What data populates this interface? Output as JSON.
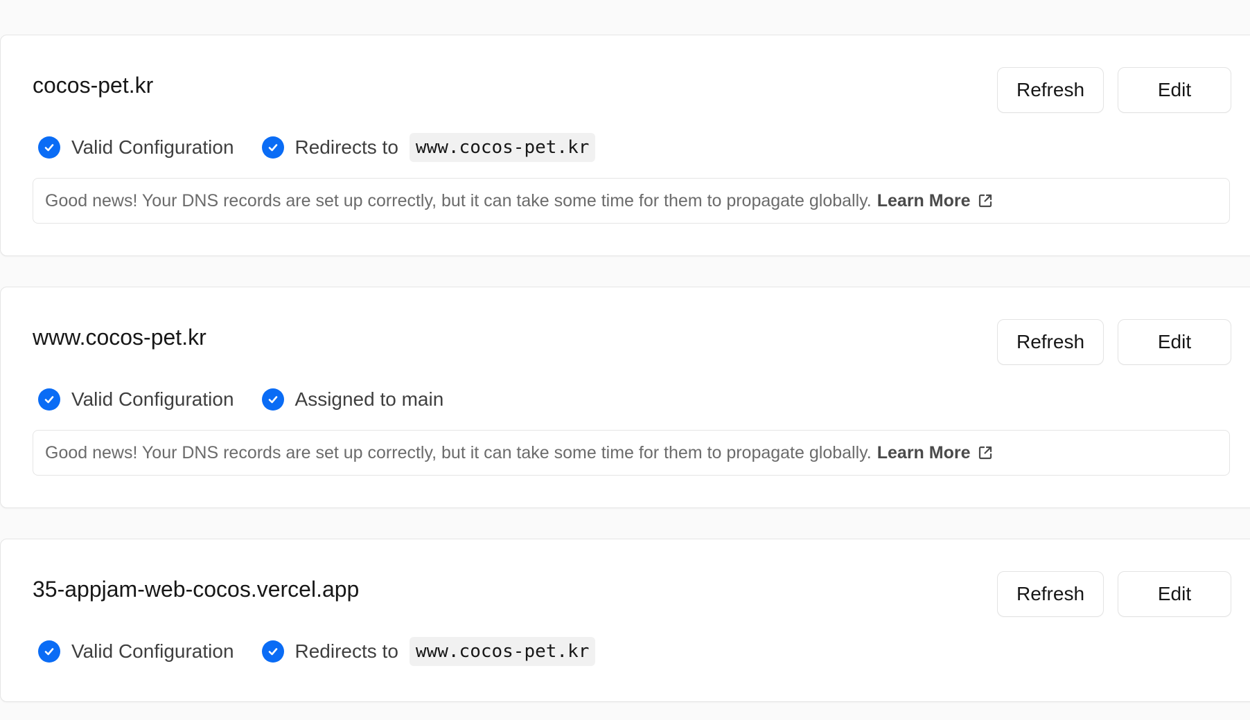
{
  "colors": {
    "check_blue": "#0a6cf5",
    "page_background": "#fafafa",
    "card_background": "#ffffff"
  },
  "domains": [
    {
      "name": "cocos-pet.kr",
      "refresh_label": "Refresh",
      "edit_label": "Edit",
      "status_1": "Valid Configuration",
      "status_2": "Redirects to",
      "status_2_target": "www.cocos-pet.kr",
      "notice_text": "Good news! Your DNS records are set up correctly, but it can take some time for them to propagate globally.",
      "notice_link": "Learn More",
      "icons": [
        "check-circle-icon",
        "external-link-icon"
      ]
    },
    {
      "name": "www.cocos-pet.kr",
      "refresh_label": "Refresh",
      "edit_label": "Edit",
      "status_1": "Valid Configuration",
      "status_2": "Assigned to main",
      "notice_text": "Good news! Your DNS records are set up correctly, but it can take some time for them to propagate globally.",
      "notice_link": "Learn More",
      "icons": [
        "check-circle-icon",
        "external-link-icon"
      ]
    },
    {
      "name": "35-appjam-web-cocos.vercel.app",
      "refresh_label": "Refresh",
      "edit_label": "Edit",
      "status_1": "Valid Configuration",
      "status_2": "Redirects to",
      "status_2_target": "www.cocos-pet.kr",
      "icons": [
        "check-circle-icon"
      ]
    }
  ]
}
